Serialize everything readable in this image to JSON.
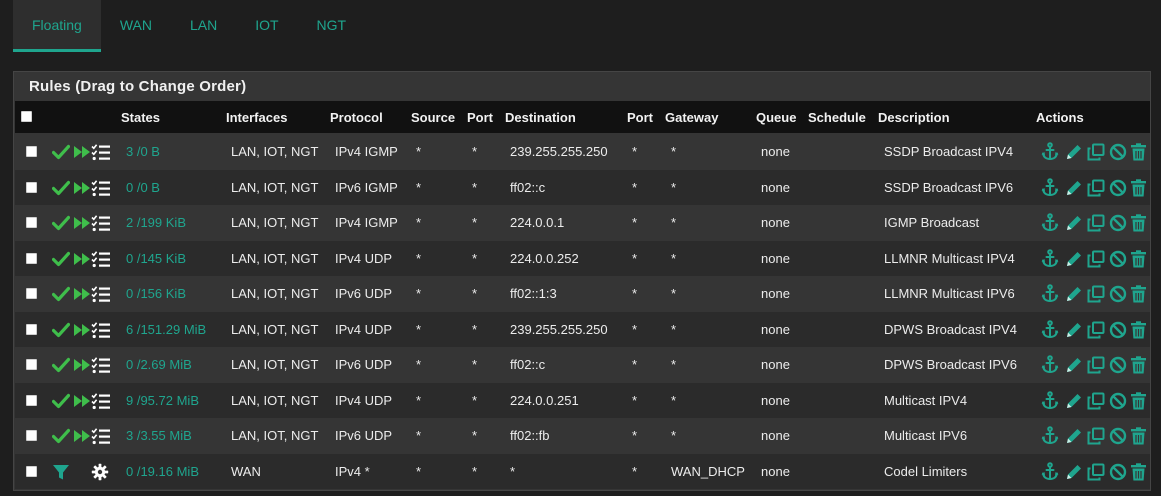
{
  "tabs": [
    {
      "label": "Floating",
      "active": true
    },
    {
      "label": "WAN",
      "active": false
    },
    {
      "label": "LAN",
      "active": false
    },
    {
      "label": "IOT",
      "active": false
    },
    {
      "label": "NGT",
      "active": false
    }
  ],
  "panel": {
    "title": "Rules (Drag to Change Order)"
  },
  "columns": {
    "states": "States",
    "interfaces": "Interfaces",
    "protocol": "Protocol",
    "source": "Source",
    "source_port": "Port",
    "destination": "Destination",
    "dest_port": "Port",
    "gateway": "Gateway",
    "queue": "Queue",
    "schedule": "Schedule",
    "description": "Description",
    "actions": "Actions"
  },
  "colors": {
    "accent": "#1fa58e",
    "pass_check": "#3fbe4b",
    "filter": "#1fa58e"
  },
  "rules": [
    {
      "type_icon": "check-icon",
      "states": "3 /0 B",
      "interfaces": "LAN, IOT, NGT",
      "protocol": "IPv4 IGMP",
      "source": "*",
      "source_port": "*",
      "destination": "239.255.255.250",
      "dest_port": "*",
      "gateway": "*",
      "queue": "none",
      "schedule": "",
      "description": "SSDP Broadcast IPV4"
    },
    {
      "type_icon": "check-icon",
      "states": "0 /0 B",
      "interfaces": "LAN, IOT, NGT",
      "protocol": "IPv6 IGMP",
      "source": "*",
      "source_port": "*",
      "destination": "ff02::c",
      "dest_port": "*",
      "gateway": "*",
      "queue": "none",
      "schedule": "",
      "description": "SSDP Broadcast IPV6"
    },
    {
      "type_icon": "check-icon",
      "states": "2 /199 KiB",
      "interfaces": "LAN, IOT, NGT",
      "protocol": "IPv4 IGMP",
      "source": "*",
      "source_port": "*",
      "destination": "224.0.0.1",
      "dest_port": "*",
      "gateway": "*",
      "queue": "none",
      "schedule": "",
      "description": "IGMP Broadcast"
    },
    {
      "type_icon": "check-icon",
      "states": "0 /145 KiB",
      "interfaces": "LAN, IOT, NGT",
      "protocol": "IPv4 UDP",
      "source": "*",
      "source_port": "*",
      "destination": "224.0.0.252",
      "dest_port": "*",
      "gateway": "*",
      "queue": "none",
      "schedule": "",
      "description": "LLMNR Multicast IPV4"
    },
    {
      "type_icon": "check-icon",
      "states": "0 /156 KiB",
      "interfaces": "LAN, IOT, NGT",
      "protocol": "IPv6 UDP",
      "source": "*",
      "source_port": "*",
      "destination": "ff02::1:3",
      "dest_port": "*",
      "gateway": "*",
      "queue": "none",
      "schedule": "",
      "description": "LLMNR Multicast IPV6"
    },
    {
      "type_icon": "check-icon",
      "states": "6 /151.29 MiB",
      "interfaces": "LAN, IOT, NGT",
      "protocol": "IPv4 UDP",
      "source": "*",
      "source_port": "*",
      "destination": "239.255.255.250",
      "dest_port": "*",
      "gateway": "*",
      "queue": "none",
      "schedule": "",
      "description": "DPWS Broadcast IPV4"
    },
    {
      "type_icon": "check-icon",
      "states": "0 /2.69 MiB",
      "interfaces": "LAN, IOT, NGT",
      "protocol": "IPv6 UDP",
      "source": "*",
      "source_port": "*",
      "destination": "ff02::c",
      "dest_port": "*",
      "gateway": "*",
      "queue": "none",
      "schedule": "",
      "description": "DPWS Broadcast IPV6"
    },
    {
      "type_icon": "check-icon",
      "states": "9 /95.72 MiB",
      "interfaces": "LAN, IOT, NGT",
      "protocol": "IPv4 UDP",
      "source": "*",
      "source_port": "*",
      "destination": "224.0.0.251",
      "dest_port": "*",
      "gateway": "*",
      "queue": "none",
      "schedule": "",
      "description": "Multicast IPV4"
    },
    {
      "type_icon": "check-icon",
      "states": "3 /3.55 MiB",
      "interfaces": "LAN, IOT, NGT",
      "protocol": "IPv6 UDP",
      "source": "*",
      "source_port": "*",
      "destination": "ff02::fb",
      "dest_port": "*",
      "gateway": "*",
      "queue": "none",
      "schedule": "",
      "description": "Multicast IPV6"
    },
    {
      "type_icon": "filter-icon",
      "states": "0 /19.16 MiB",
      "interfaces": "WAN",
      "protocol": "IPv4 *",
      "source": "*",
      "source_port": "*",
      "destination": "*",
      "dest_port": "*",
      "gateway": "WAN_DHCP",
      "queue": "none",
      "schedule": "",
      "description": "Codel Limiters"
    }
  ]
}
